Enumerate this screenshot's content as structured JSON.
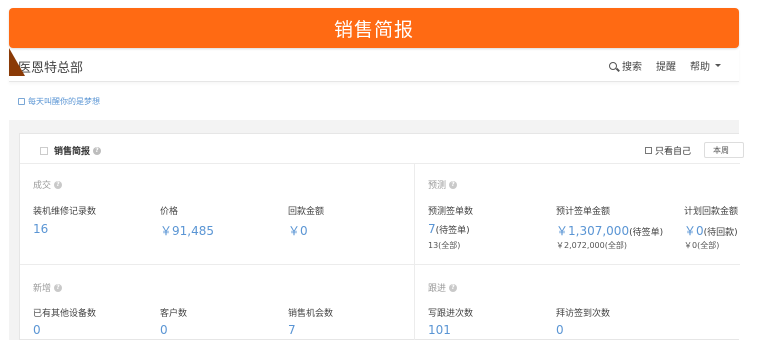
{
  "banner": {
    "title": "销售简报"
  },
  "topbar": {
    "company": "医恩特总部",
    "nav": {
      "search": "搜索",
      "remind": "提醒",
      "help": "帮助"
    }
  },
  "tip": {
    "link": "每天叫醒你的是梦想"
  },
  "panel": {
    "title": "销售简报",
    "only_mine": "只看自己",
    "period": "本周",
    "sections": {
      "deal": {
        "title": "成交",
        "items": [
          {
            "label": "装机维修记录数",
            "value": "16"
          },
          {
            "label": "价格",
            "value": "￥91,485"
          },
          {
            "label": "回款金额",
            "value": "￥0"
          }
        ]
      },
      "forecast": {
        "title": "预测",
        "items": [
          {
            "label": "预测签单数",
            "value": "7",
            "value_note": "(待签单)",
            "sub": "13(全部)"
          },
          {
            "label": "预计签单金额",
            "value": "￥1,307,000",
            "value_note": "(待签单)",
            "sub": "￥2,072,000(全部)"
          },
          {
            "label": "计划回款金额",
            "value": "￥0",
            "value_note": "(待回款)",
            "sub": "￥0(全部)"
          }
        ]
      },
      "new": {
        "title": "新增",
        "items": [
          {
            "label": "已有其他设备数",
            "value": "0"
          },
          {
            "label": "客户数",
            "value": "0"
          },
          {
            "label": "销售机会数",
            "value": "7"
          }
        ]
      },
      "follow": {
        "title": "跟进",
        "items": [
          {
            "label": "写跟进次数",
            "value": "101"
          },
          {
            "label": "拜访签到次数",
            "value": "0"
          }
        ]
      }
    }
  }
}
